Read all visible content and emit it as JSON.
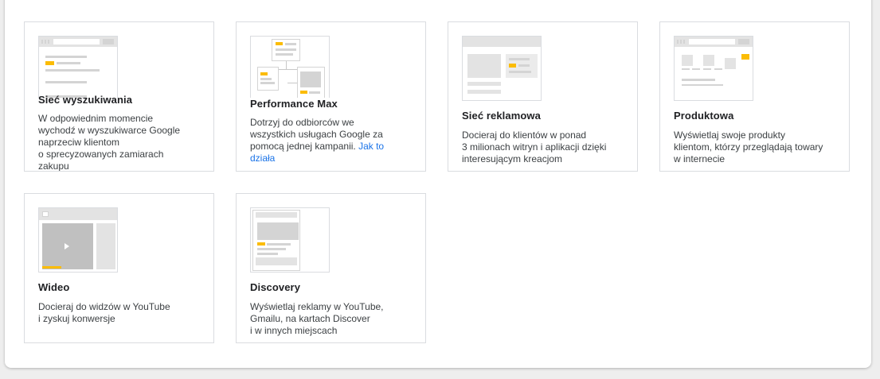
{
  "cards": [
    {
      "title": "Sieć wyszukiwania",
      "desc_lines": [
        "W odpowiednim momencie",
        "wychodź w wyszukiwarce Google",
        "naprzeciw klientom",
        "o sprecyzowanych zamiarach",
        "zakupu"
      ]
    },
    {
      "title": "Performance Max",
      "desc_lines": [
        "Dotrzyj do odbiorców we",
        "wszystkich usługach Google za"
      ],
      "desc_last_text": "pomocą jednej kampanii. ",
      "link_part1": "Jak to",
      "link_part2": "działa"
    },
    {
      "title": "Sieć reklamowa",
      "desc_lines": [
        "Docieraj do klientów w ponad",
        "3 milionach witryn i aplikacji dzięki",
        "interesującym kreacjom"
      ]
    },
    {
      "title": "Produktowa",
      "desc_lines": [
        "Wyświetlaj swoje produkty",
        "klientom, którzy przeglądają towary",
        "w internecie"
      ]
    },
    {
      "title": "Wideo",
      "desc_lines": [
        "Docieraj do widzów w YouTube",
        "i zyskuj konwersje"
      ]
    },
    {
      "title": "Discovery",
      "desc_lines": [
        "Wyświetlaj reklamy w YouTube,",
        "Gmailu, na kartach Discover",
        "i w innych miejscach"
      ]
    }
  ],
  "colors": {
    "accent": "#fbbc04",
    "link": "#1a73e8",
    "border": "#dadce0"
  },
  "icons": [
    "search-network-illustration",
    "performance-max-illustration",
    "display-network-illustration",
    "shopping-illustration",
    "video-illustration",
    "discovery-illustration",
    "play-icon"
  ]
}
